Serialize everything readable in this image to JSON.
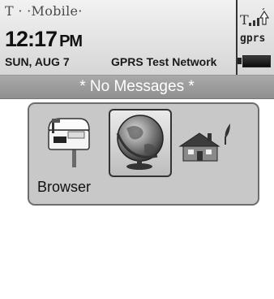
{
  "status": {
    "carrier": "T · ·Mobile·",
    "time": "12:17",
    "ampm": "PM",
    "date": "SUN, AUG 7",
    "network": "GPRS Test Network",
    "data_indicator": "gprs"
  },
  "banner": {
    "text": "* No Messages *"
  },
  "home": {
    "selected_label": "Browser",
    "apps": [
      {
        "icon": "mailbox-icon"
      },
      {
        "icon": "globe-icon"
      },
      {
        "icon": "house-icon"
      }
    ]
  },
  "colors": {
    "banner_bg": "#9c9c9c",
    "panel_bg": "#c8c8c8",
    "status_bg": "#e2e2e2"
  }
}
